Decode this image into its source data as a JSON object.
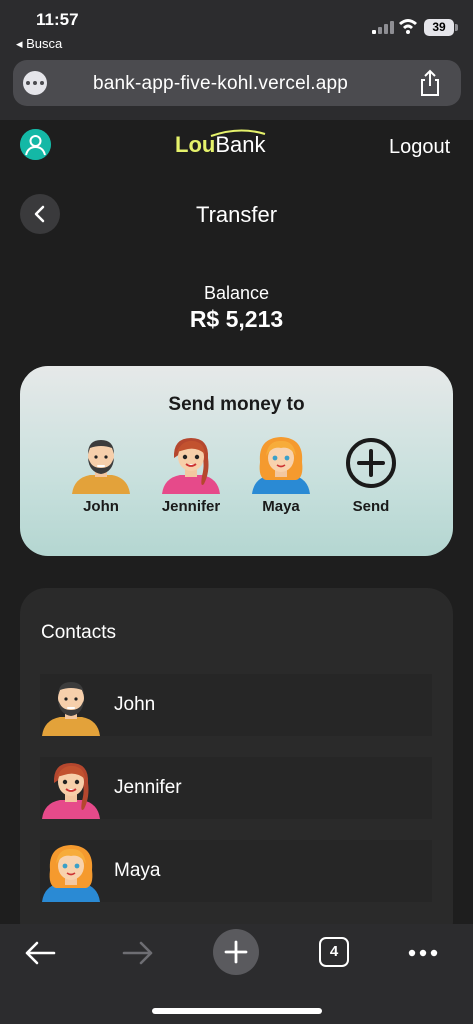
{
  "status_bar": {
    "time": "11:57",
    "back_app": "◂ Busca",
    "battery": "39"
  },
  "browser": {
    "url": "bank-app-five-kohl.vercel.app",
    "tabs_count": "4"
  },
  "header": {
    "logo_part1": "Lou",
    "logo_part2": "Bank",
    "logout_label": "Logout"
  },
  "page": {
    "title": "Transfer",
    "balance_label": "Balance",
    "balance_value": "R$ 5,213"
  },
  "send_money": {
    "title": "Send money to",
    "recipients": [
      {
        "name": "John"
      },
      {
        "name": "Jennifer"
      },
      {
        "name": "Maya"
      }
    ],
    "send_label": "Send"
  },
  "contacts": {
    "title": "Contacts",
    "items": [
      {
        "name": "John"
      },
      {
        "name": "Jennifer"
      },
      {
        "name": "Maya"
      }
    ]
  },
  "icons": [
    "profile-icon",
    "back-arrow-icon",
    "plus-circle-icon",
    "share-icon",
    "more-icon",
    "forward-icon",
    "new-tab-icon",
    "tabs-icon"
  ],
  "colors": {
    "brand_accent": "#e5f26b",
    "profile_accent": "#14b8a6",
    "card_gradient_top": "#e6e9e9",
    "card_gradient_bottom": "#b4d6d1",
    "background": "#1e1e1e"
  }
}
